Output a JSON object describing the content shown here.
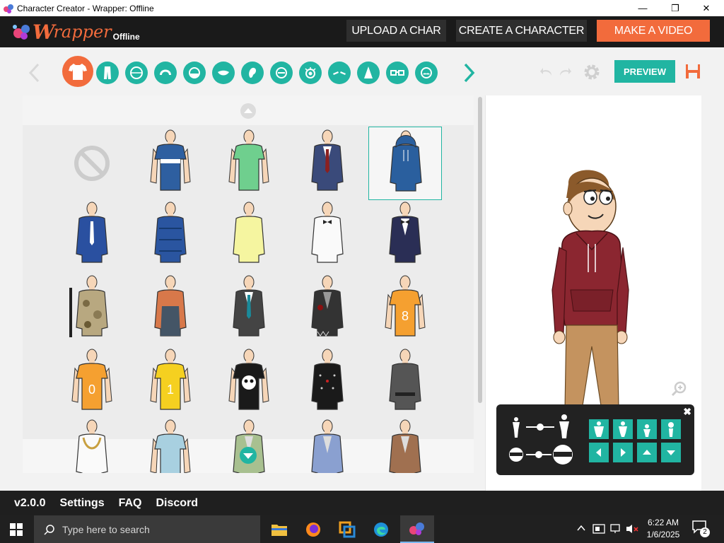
{
  "window": {
    "title": "Character Creator - Wrapper: Offline",
    "minimize": "—",
    "maximize": "❐",
    "close": "✕"
  },
  "logo": {
    "w": "W",
    "rapper": "rapper",
    "offline": "Offline"
  },
  "header": {
    "upload": "UPLOAD A CHAR",
    "create": "CREATE A CHARACTER",
    "make_video": "MAKE A VIDEO"
  },
  "toolbar": {
    "categories": [
      "shirt-icon",
      "pants-icon",
      "face-shape-icon",
      "hair-icon",
      "beard-icon",
      "mouth-icon",
      "ear-icon",
      "head-accessory-icon",
      "eye-icon",
      "eyebrow-icon",
      "nose-icon",
      "glasses-icon",
      "mustache-icon"
    ],
    "preview": "PREVIEW"
  },
  "grid": {
    "rows": [
      [
        "none",
        "Blue striped polo",
        "Green t-shirt",
        "Navy blazer with tie",
        "Blue hoodie"
      ],
      [
        "Police uniform",
        "Blue puffer jacket",
        "Yellow button shirt",
        "White tuxedo shirt",
        "Navy tuxedo jacket"
      ],
      [
        "Camo jacket with rifle",
        "Orange shirt with overalls",
        "Dark suit with teal tie",
        "Torn zombie suit",
        "Orange jersey 8"
      ],
      [
        "Orange jersey 0",
        "Yellow jersey 1",
        "Skull t-shirt",
        "Studded leather jacket",
        "Gray karate gi"
      ],
      [
        "Gold chain shirt",
        "Light blue shirt",
        "Green vest",
        "Blue vest",
        "Brown vest"
      ]
    ],
    "selected": "Blue hoodie",
    "jersey_numbers": {
      "orange_8": "8",
      "orange_0": "0",
      "yellow_1": "1"
    }
  },
  "footer": {
    "version": "v2.0.0",
    "settings": "Settings",
    "faq": "FAQ",
    "discord": "Discord"
  },
  "taskbar": {
    "search_placeholder": "Type here to search",
    "time": "6:22 AM",
    "date": "1/6/2025",
    "notifications": "2"
  },
  "colors": {
    "accent": "#21b5a2",
    "orange": "#f26b3c",
    "dark": "#1a1a1a"
  }
}
